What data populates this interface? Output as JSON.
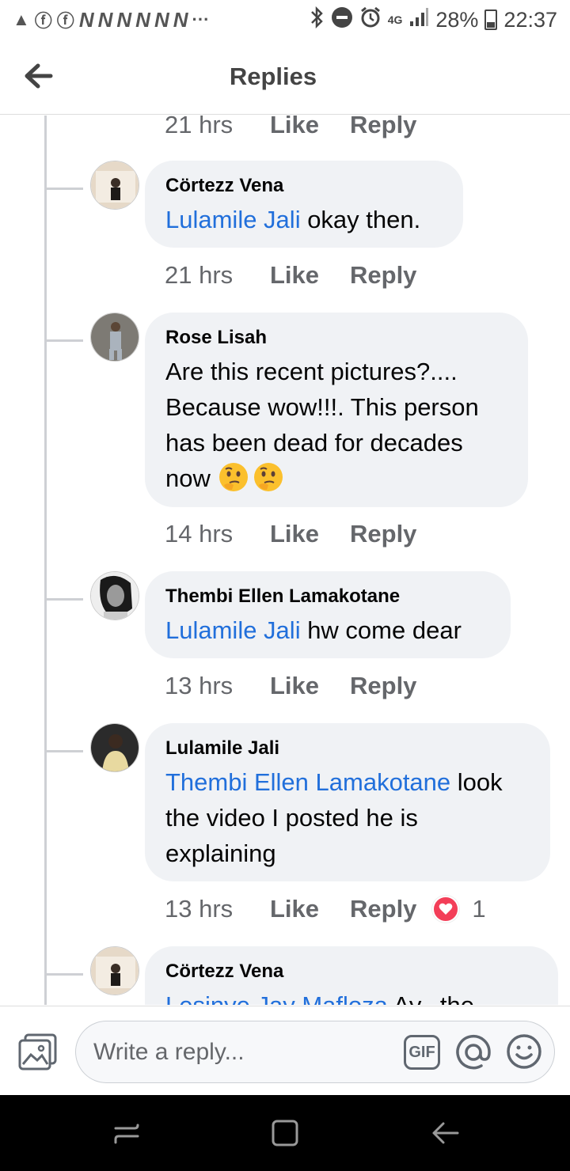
{
  "status_bar": {
    "network": "4G",
    "battery": "28%",
    "time": "22:37"
  },
  "header": {
    "title": "Replies"
  },
  "top_meta": {
    "time": "21 hrs",
    "like": "Like",
    "reply": "Reply"
  },
  "comments": [
    {
      "author": "Cörtezz Vena",
      "mention": "Lulamile Jali",
      "text": " okay then.",
      "time": "21 hrs",
      "like": "Like",
      "reply": "Reply"
    },
    {
      "author": "Rose Lisah",
      "mention": "",
      "text": "Are this recent pictures?.... Because wow!!!. This person has been dead for decades now",
      "time": "14 hrs",
      "like": "Like",
      "reply": "Reply",
      "emoji": [
        "thinking-face",
        "thinking-face"
      ]
    },
    {
      "author": "Thembi Ellen Lamakotane",
      "mention": "Lulamile Jali",
      "text": " hw come dear",
      "time": "13 hrs",
      "like": "Like",
      "reply": "Reply"
    },
    {
      "author": "Lulamile Jali",
      "mention": "Thembi Ellen Lamakotane",
      "text": " look the video I posted he is explaining",
      "time": "13 hrs",
      "like": "Like",
      "reply": "Reply",
      "reaction": {
        "icon": "heart-icon",
        "count": "1"
      }
    },
    {
      "author": "Cörtezz Vena",
      "mention": "Lesinye Jay Mafloza",
      "text": " Ay...the"
    }
  ],
  "composer": {
    "placeholder": "Write a reply...",
    "gif_label": "GIF"
  },
  "colors": {
    "mention": "#216fdb",
    "bubble": "#f0f2f5",
    "heart": "#f33e58"
  }
}
